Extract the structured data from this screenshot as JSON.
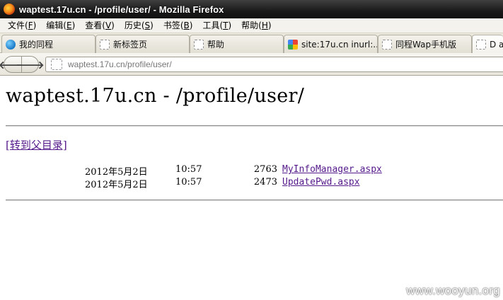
{
  "window": {
    "title": "waptest.17u.cn - /profile/user/ - Mozilla Firefox"
  },
  "menu": [
    {
      "label": "文件(",
      "key": "F",
      "end": ")"
    },
    {
      "label": "编辑(",
      "key": "E",
      "end": ")"
    },
    {
      "label": "查看(",
      "key": "V",
      "end": ")"
    },
    {
      "label": "历史(",
      "key": "S",
      "end": ")"
    },
    {
      "label": "书签(",
      "key": "B",
      "end": ")"
    },
    {
      "label": "工具(",
      "key": "T",
      "end": ")"
    },
    {
      "label": "帮助(",
      "key": "H",
      "end": ")"
    }
  ],
  "tabs": [
    {
      "label": "我的同程",
      "icon": "tongcheng-logo-icon"
    },
    {
      "label": "新标签页",
      "icon": "blank-page-icon"
    },
    {
      "label": "帮助",
      "icon": "blank-page-icon"
    },
    {
      "label": "site:17u.cn inurl:...",
      "icon": "google-icon"
    },
    {
      "label": "同程Wap手机版",
      "icon": "blank-page-icon"
    },
    {
      "label": "D a",
      "icon": "blank-page-icon"
    }
  ],
  "nav": {
    "back_glyph": "🡐",
    "forward_glyph": "🡒",
    "url": "waptest.17u.cn/profile/user/"
  },
  "page": {
    "heading": "waptest.17u.cn - /profile/user/",
    "parent_link": "[转到父目录]",
    "files": [
      {
        "date": "2012年5月2日",
        "time": "10:57",
        "size": "2763",
        "name": "MyInfoManager.aspx"
      },
      {
        "date": "2012年5月2日",
        "time": "10:57",
        "size": "2473",
        "name": "UpdatePwd.aspx"
      }
    ]
  },
  "watermark": "www.wooyun.org"
}
